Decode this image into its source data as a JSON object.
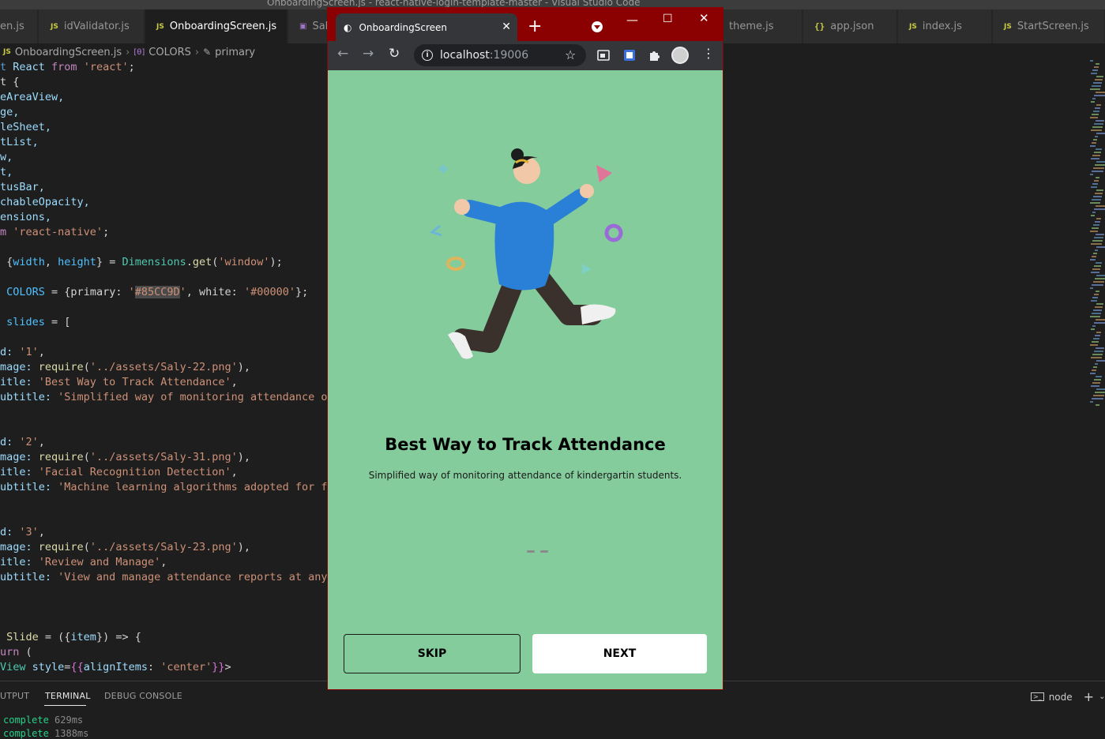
{
  "vscode": {
    "window_title": "OnboardingScreen.js - react-native-login-template-master - Visual Studio Code",
    "tabs": [
      {
        "label": "en.js",
        "badge": ""
      },
      {
        "label": "idValidator.js",
        "badge": "JS"
      },
      {
        "label": "OnboardingScreen.js",
        "badge": "JS"
      },
      {
        "label": "Sal",
        "badge": ""
      },
      {
        "label": "theme.js",
        "badge": ""
      },
      {
        "label": "app.json",
        "badge": "{}"
      },
      {
        "label": "index.js",
        "badge": "JS"
      },
      {
        "label": "StartScreen.js",
        "badge": "JS"
      }
    ],
    "breadcrumb": {
      "file_badge": "JS",
      "file": "OnboardingScreen.js",
      "symbol_badge": "[θ]",
      "symbol": "COLORS",
      "property": "primary"
    },
    "code": {
      "l1": {
        "a": "t ",
        "b": "React",
        "c": " from ",
        "d": "'react'",
        "e": ";"
      },
      "l2": "t {",
      "l3": "eAreaView,",
      "l4": "ge,",
      "l5": "leSheet,",
      "l6": "tList,",
      "l7": "w,",
      "l8": "t,",
      "l9": "tusBar,",
      "l10": "chableOpacity,",
      "l11": "ensions,",
      "l12": {
        "a": "m ",
        "b": "'react-native'",
        "c": ";"
      },
      "l14": {
        "a": " {",
        "b": "width",
        "c": ", ",
        "d": "height",
        "e": "} = ",
        "f": "Dimensions",
        "g": ".",
        "h": "get",
        "i": "(",
        "j": "'window'",
        "k": ");"
      },
      "l16": {
        "a": " ",
        "b": "COLORS",
        "c": " = {primary: ",
        "d": "'",
        "e": "#85CC9D",
        "f": "'",
        "g": ", white: ",
        "h": "'#00000'",
        "i": "};"
      },
      "l18": {
        "a": " ",
        "b": "slides",
        "c": " = ["
      },
      "l20": {
        "a": "d: ",
        "b": "'1'",
        "c": ","
      },
      "l21": {
        "a": "mage: ",
        "b": "require",
        "c": "(",
        "d": "'../assets/Saly-22.png'",
        "e": "),"
      },
      "l22": {
        "a": "itle: ",
        "b": "'Best Way to Track Attendance'",
        "c": ","
      },
      "l23": {
        "a": "ubtitle: ",
        "b": "'Simplified way of monitoring attendance of k"
      },
      "l26": {
        "a": "d: ",
        "b": "'2'",
        "c": ","
      },
      "l27": {
        "a": "mage: ",
        "b": "require",
        "c": "(",
        "d": "'../assets/Saly-31.png'",
        "e": "),"
      },
      "l28": {
        "a": "itle: ",
        "b": "'Facial Recognition Detection'",
        "c": ","
      },
      "l29": {
        "a": "ubtitle: ",
        "b": "'Machine learning algorithms adopted for faci"
      },
      "l32": {
        "a": "d: ",
        "b": "'3'",
        "c": ","
      },
      "l33": {
        "a": "mage: ",
        "b": "require",
        "c": "(",
        "d": "'../assets/Saly-23.png'",
        "e": "),"
      },
      "l34": {
        "a": "itle: ",
        "b": "'Review and Manage'",
        "c": ","
      },
      "l35": {
        "a": "ubtitle: ",
        "b": "'View and manage attendance reports at any ti"
      },
      "l39": {
        "a": " ",
        "b": "Slide",
        "c": " = ({",
        "d": "item",
        "e": "}) => {"
      },
      "l40": {
        "a": "urn",
        "b": " ("
      },
      "l41": {
        "a": "View",
        "b": " ",
        "c": "style",
        "d": "=",
        "e": "{{",
        "f": "alignItems",
        "g": ": ",
        "h": "'center'",
        "i": "}}",
        "j": ">"
      }
    },
    "panel": {
      "tabs": [
        "UTPUT",
        "TERMINAL",
        "DEBUG CONSOLE"
      ],
      "active_tab": "TERMINAL",
      "shell": "node",
      "terminal_lines": [
        {
          "status": "complete",
          "time": "629ms"
        },
        {
          "status": "complete",
          "time": "1388ms"
        }
      ]
    }
  },
  "browser": {
    "tab_title": "OnboardingScreen",
    "url_host": "localhost",
    "url_port": ":19006",
    "frame_color": "#8B0000"
  },
  "app": {
    "background": "#85CC9D",
    "slide": {
      "title": "Best Way to Track Attendance",
      "subtitle": "Simplified way of monitoring attendance of kindergartin students."
    },
    "indicator": {
      "count": 2,
      "active_index": 0
    },
    "buttons": {
      "skip": "SKIP",
      "next": "NEXT"
    }
  }
}
